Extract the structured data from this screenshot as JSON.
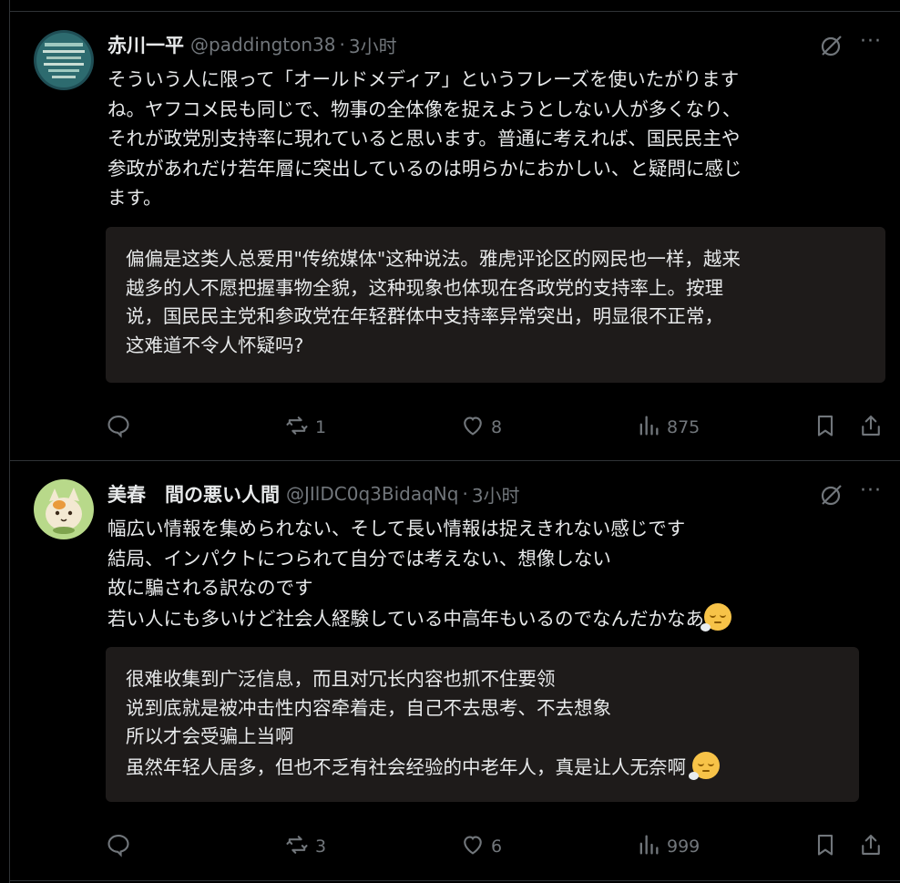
{
  "posts": [
    {
      "author_name": "赤川一平",
      "handle": "@paddington38",
      "separator": "·",
      "time": "3小时",
      "more": "···",
      "text": "そういう人に限って「オールドメディア」というフレーズを使いたがります\nね。ヤフコメ民も同じで、物事の全体像を捉えようとしない人が多くなり、\nそれが政党別支持率に現れていると思います。普通に考えれば、国民民主や\n参政があれだけ若年層に突出しているのは明らかにおかしい、と疑問に感じ\nます。",
      "translation": "偏偏是这类人总爱用\"传统媒体\"这种说法。雅虎评论区的网民也一样，越来\n越多的人不愿把握事物全貌，这种现象也体现在各政党的支持率上。按理\n说，国民民主党和参政党在年轻群体中支持率异常突出，明显很不正常，\n这难道不令人怀疑吗?",
      "stats": {
        "replies": "",
        "reposts": "1",
        "likes": "8",
        "views": "875"
      }
    },
    {
      "author_name": "美春　間の悪い人間",
      "handle": "@JIlDC0q3BidaqNq",
      "separator": "·",
      "time": "3小时",
      "more": "···",
      "text_lines": [
        "幅広い情報を集められない、そして長い情報は捉えきれない感じです",
        "結局、インパクトにつられて自分では考えない、想像しない",
        "故に騙される訳なのです",
        "若い人にも多いけど社会人経験している中高年もいるのでなんだかなあ"
      ],
      "translation_lines": [
        "很难收集到广泛信息，而且对冗长内容也抓不住要领",
        "说到底就是被冲击性内容牵着走，自己不去思考、不去想象",
        "所以才会受骗上当啊",
        "虽然年轻人居多，但也不乏有社会经验的中老年人，真是让人无奈啊"
      ],
      "emoji": "relieved-face-emoji",
      "stats": {
        "replies": "",
        "reposts": "3",
        "likes": "6",
        "views": "999"
      }
    }
  ],
  "colors": {
    "background": "#000000",
    "text": "#e7e9ea",
    "muted": "#71767b",
    "translation_bg": "#1e1b1a",
    "divider": "#2f3336"
  },
  "icons": [
    "reply-icon",
    "repost-icon",
    "like-icon",
    "views-icon",
    "bookmark-icon",
    "share-icon",
    "grok-icon",
    "more-icon"
  ]
}
